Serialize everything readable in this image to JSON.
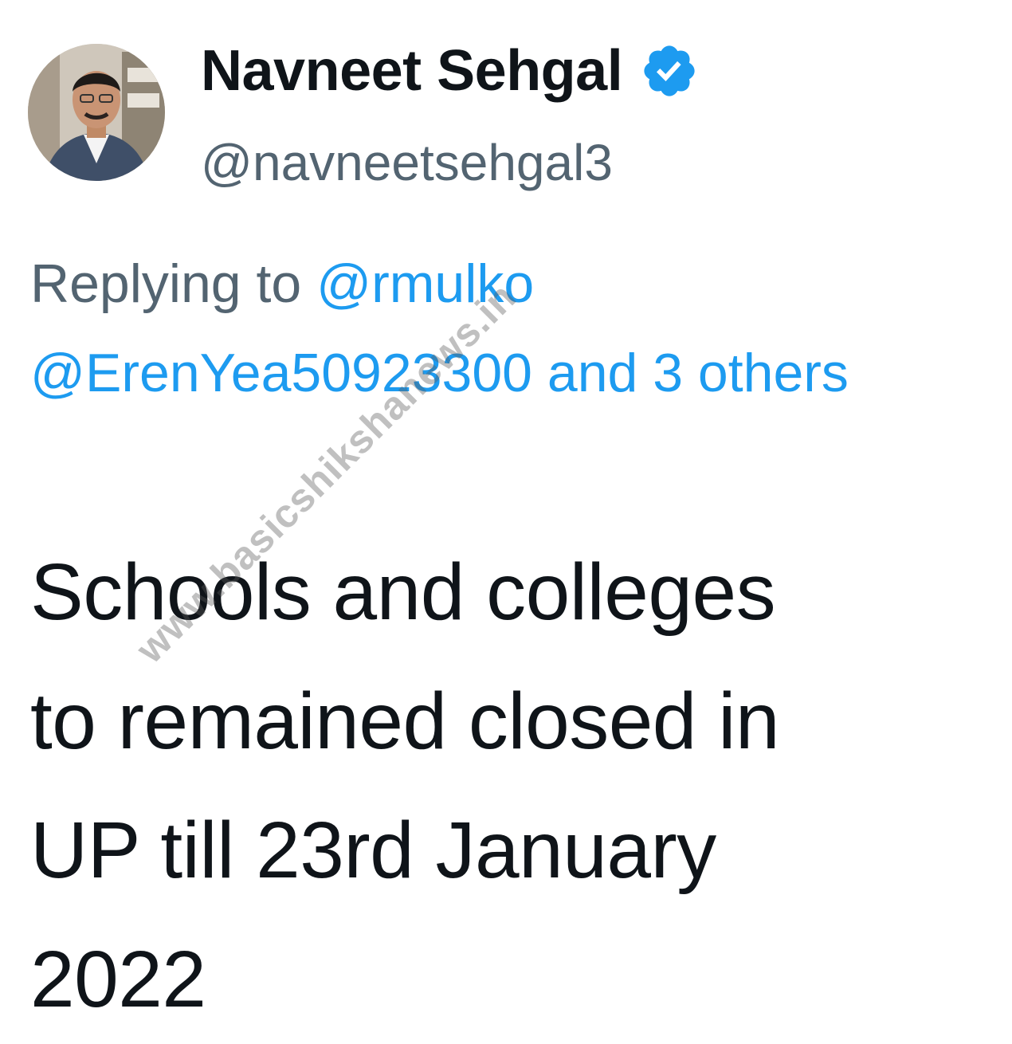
{
  "author": {
    "display_name": "Navneet Sehgal",
    "handle": "@navneetsehgal3",
    "verified": true
  },
  "reply": {
    "prefix": "Replying to",
    "mention_1": "@rmulko",
    "mention_2": "@ErenYea50923300",
    "and_others": "and 3 others"
  },
  "tweet": {
    "line_1": "Schools and colleges",
    "line_2": "to remained closed in",
    "line_3": "UP till 23rd January",
    "line_4": "2022"
  },
  "watermark": "www.basicshikshanews.in",
  "colors": {
    "link": "#1d9bf0",
    "secondary_text": "#536471",
    "primary_text": "#0f1419",
    "verified": "#1d9bf0"
  },
  "icons": {
    "verified": "verified-badge-icon",
    "avatar": "profile-photo"
  }
}
